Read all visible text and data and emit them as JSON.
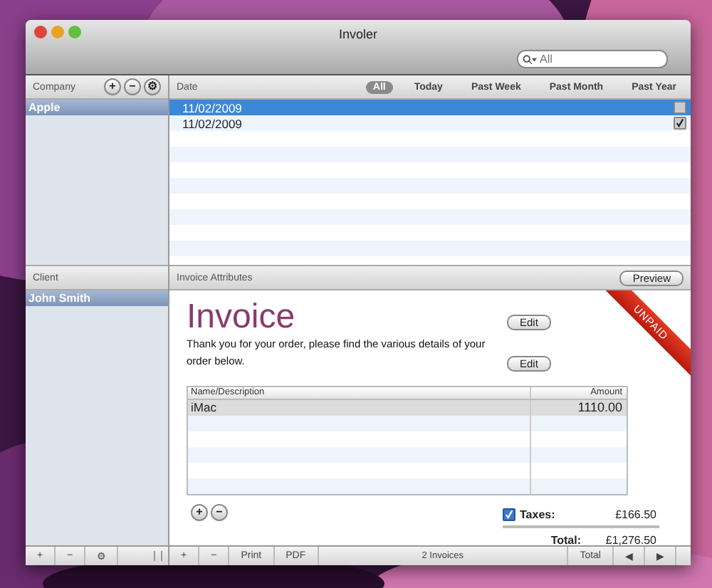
{
  "window": {
    "title": "Involer"
  },
  "search": {
    "placeholder": "All"
  },
  "company_panel": {
    "header": "Company",
    "buttons": [
      "+",
      "−",
      "⚙"
    ],
    "items": [
      {
        "label": "Apple",
        "selected": true
      }
    ]
  },
  "invoice_list": {
    "header": "Date",
    "filters": [
      {
        "label": "All",
        "selected": true
      },
      {
        "label": "Today",
        "selected": false
      },
      {
        "label": "Past Week",
        "selected": false
      },
      {
        "label": "Past Month",
        "selected": false
      },
      {
        "label": "Past Year",
        "selected": false
      }
    ],
    "rows": [
      {
        "date": "11/02/2009",
        "selected": true,
        "checked": false
      },
      {
        "date": "11/02/2009",
        "selected": false,
        "checked": true
      }
    ]
  },
  "client_panel": {
    "header": "Client",
    "items": [
      {
        "label": "John Smith",
        "selected": true
      }
    ]
  },
  "attributes": {
    "header": "Invoice Attributes",
    "preview": "Preview"
  },
  "invoice": {
    "title": "Invoice",
    "ribbon": "UNPAID",
    "edit_buttons": [
      "Edit",
      "Edit"
    ],
    "message": "Thank you for your order, please find the various details of your order below.",
    "columns": [
      "Name/Description",
      "Amount"
    ],
    "rows": [
      {
        "name": "iMac",
        "amount": "1110.00"
      }
    ],
    "line_buttons": [
      "+",
      "−"
    ],
    "taxes": {
      "label": "Taxes:",
      "checked": true,
      "value": "£166.50"
    },
    "total": {
      "label": "Total:",
      "value": "£1,276.50"
    }
  },
  "bottom_bar": {
    "left": [
      "+",
      "−",
      "⚙"
    ],
    "right": [
      "+",
      "−",
      "Print",
      "PDF"
    ],
    "status": "2 Invoices",
    "total": "Total",
    "prev": "◀",
    "next": "▶"
  }
}
